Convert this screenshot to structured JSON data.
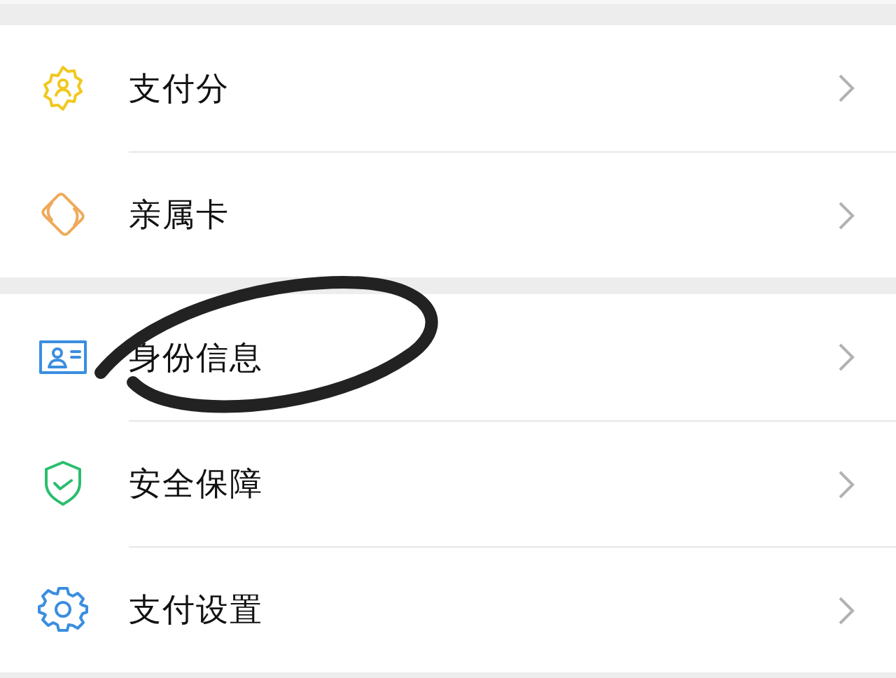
{
  "sections": [
    {
      "items": [
        {
          "kind": "score",
          "label": "支付分",
          "circled": false
        },
        {
          "kind": "family-card",
          "label": "亲属卡",
          "circled": false
        }
      ]
    },
    {
      "items": [
        {
          "kind": "id-card",
          "label": "身份信息",
          "circled": true
        },
        {
          "kind": "shield",
          "label": "安全保障",
          "circled": false
        },
        {
          "kind": "gear",
          "label": "支付设置",
          "circled": false
        }
      ]
    }
  ]
}
